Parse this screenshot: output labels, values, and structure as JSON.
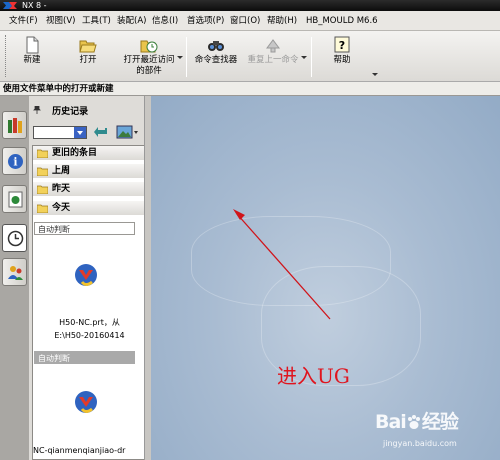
{
  "titlebar": {
    "title": "NX 8 -"
  },
  "menubar": {
    "items": [
      "文件(F)",
      "视图(V)",
      "工具(T)",
      "装配(A)",
      "信息(I)",
      "首选项(P)",
      "窗口(O)",
      "帮助(H)",
      "HB_MOULD  M6.6"
    ]
  },
  "toolbar": {
    "new": "新建",
    "open": "打开",
    "recent_line1": "打开最近访问",
    "recent_line2": "的部件",
    "command_finder": "命令查找器",
    "repeat_last": "重复上一命令",
    "help": "帮助"
  },
  "cueline": {
    "text": "使用文件菜单中的打开或新建"
  },
  "history": {
    "title": "历史记录",
    "groups": [
      "更旧的条目",
      "上周",
      "昨天",
      "今天"
    ],
    "items": [
      {
        "label": "自动判断",
        "caption_line1": "H50-NC.prt，从",
        "caption_line2": "E:\\H50-20160414"
      },
      {
        "label": "自动判断",
        "caption_line1": "NC-qianmenqianjiao-dr"
      }
    ]
  },
  "annotation": {
    "text": "进入UG"
  },
  "watermark": {
    "brand": "Bai",
    "brand2": "经验",
    "site": "jingyan.baidu.com"
  },
  "colors": {
    "annotation": "#e0141e",
    "arrow": "#d0141a",
    "graphics_bg": "#a9bcd2"
  }
}
